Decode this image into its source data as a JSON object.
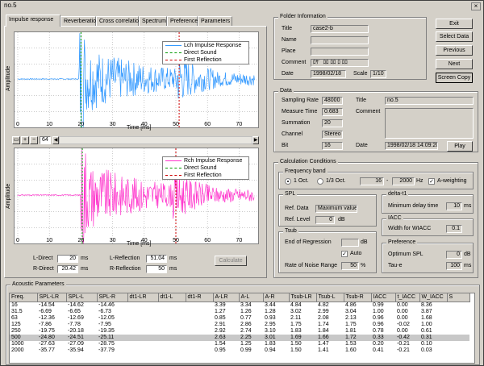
{
  "window": {
    "title": "no.5",
    "close": "×"
  },
  "tabs": [
    "Impulse response",
    "Reverberation",
    "Cross correlation",
    "Spectrum",
    "Preference",
    "Parameters"
  ],
  "plot_top": {
    "ylabel": "Amplitude",
    "xlabel": "Time [ms]",
    "xticks": [
      "0",
      "10",
      "20",
      "30",
      "40",
      "50",
      "60",
      "70"
    ],
    "legend": [
      "Lch Impulse Response",
      "Direct Sound",
      "First Reflection"
    ],
    "colors": {
      "response": "#3399ff",
      "direct": "#009900",
      "reflection": "#cc0000"
    }
  },
  "plot_bottom": {
    "ylabel": "Amplitude",
    "xlabel": "Time [ms]",
    "xticks": [
      "0",
      "10",
      "20",
      "30",
      "40",
      "50",
      "60",
      "70"
    ],
    "legend": [
      "Rch Impulse Response",
      "Direct Sound",
      "First Reflection"
    ],
    "colors": {
      "response": "#ff33cc",
      "direct": "#009900",
      "reflection": "#cc0000"
    }
  },
  "toolbar": {
    "zoom_value": "64"
  },
  "chart_data": [
    {
      "type": "line",
      "title": "",
      "xlabel": "Time [ms]",
      "ylabel": "Amplitude",
      "xlim": [
        0,
        75
      ],
      "series": [
        {
          "name": "Lch Impulse Response"
        },
        {
          "name": "Direct Sound",
          "x": 20
        },
        {
          "name": "First Reflection",
          "x": 51.04
        }
      ]
    },
    {
      "type": "line",
      "title": "",
      "xlabel": "Time [ms]",
      "ylabel": "Amplitude",
      "xlim": [
        0,
        75
      ],
      "series": [
        {
          "name": "Rch Impulse Response"
        },
        {
          "name": "Direct Sound",
          "x": 20.42
        },
        {
          "name": "First Reflection",
          "x": 50
        }
      ]
    }
  ],
  "positions": {
    "l_direct_label": "L-Direct",
    "l_direct": "20",
    "r_direct_label": "R-Direct",
    "r_direct": "20.42",
    "l_reflection_label": "L-Reflection",
    "l_reflection": "51.04",
    "r_reflection_label": "R-Reflection",
    "r_reflection": "50",
    "unit": "ms",
    "calculate": "Calculate"
  },
  "folder": {
    "group": "Folder Information",
    "title_label": "Title",
    "title": "case2-b",
    "name_label": "Name",
    "place_label": "Place",
    "comment_label": "Comment",
    "comment": "ﾛｻﾞ ﾛﾛ ﾛﾛ ﾛ ﾛﾛ",
    "date_label": "Date",
    "date": "1998/02/18",
    "scale_label": "Scale",
    "scale": "1/10"
  },
  "buttons": {
    "exit": "Exit",
    "select": "Select Data",
    "previous": "Previous",
    "next": "Next",
    "screen_copy": "Screen Copy"
  },
  "data": {
    "group": "Data",
    "rate_label": "Sampling Rate",
    "rate": "48000",
    "mtime_label": "Measure Time",
    "mtime": "0.683",
    "sum_label": "Summation",
    "sum": "20",
    "channel_label": "Channel",
    "channel": "Stereo",
    "bit_label": "Bit",
    "bit": "16",
    "title_label": "Title",
    "title": "no.5",
    "comment_label": "Comment",
    "date_label": "Date",
    "date": "1998/02/18 14:09:20",
    "play": "Play"
  },
  "calc": {
    "group": "Calculation Conditions",
    "band_group": "Frequency band",
    "oct1": "1 Oct.",
    "oct3": "1/3 Oct.",
    "f_low": "16",
    "f_high": "2000",
    "hz": "Hz",
    "aweight": "A-weighting",
    "spl_group": "SPL",
    "ref_data_label": "Ref. Data",
    "ref_data": "Maximum value",
    "ref_level_label": "Ref. Level",
    "ref_level": "0",
    "db": "dB",
    "dt1_group": "delta-t1",
    "min_delay_label": "Minimum delay time",
    "min_delay": "10",
    "ms": "ms",
    "tsub_group": "Tsub",
    "end_reg_label": "End of Regression",
    "auto": "Auto",
    "noise_label": "Rate of Noise Range",
    "noise": "50",
    "pct": "%",
    "iacc_group": "IACC",
    "w_iacc_label": "Width for WIACC",
    "w_iacc": "0.1",
    "pref_group": "Preference",
    "opt_spl_label": "Optimum SPL",
    "opt_spl": "0",
    "tau_label": "Tau-e",
    "tau": "100"
  },
  "acoustic": {
    "group": "Acoustic Parameters",
    "headers": [
      "Freq.",
      "SPL-LR",
      "SPL-L",
      "SPL-R",
      "dt1-LR",
      "dt1-L",
      "dt1-R",
      "A-LR",
      "A-L",
      "A-R",
      "Tsub-LR",
      "Tsub-L",
      "Tsub-R",
      "IACC",
      "t_IACC",
      "W_IACC",
      "S"
    ],
    "rows": [
      [
        "16",
        "-14.54",
        "-14.62",
        "-14.46",
        "",
        "",
        "",
        "3.39",
        "3.34",
        "3.44",
        "4.84",
        "4.82",
        "4.86",
        "0.99",
        "0.00",
        "8.36",
        ""
      ],
      [
        "31.5",
        "-6.69",
        "-6.65",
        "-6.73",
        "",
        "",
        "",
        "1.27",
        "1.26",
        "1.28",
        "3.02",
        "2.99",
        "3.04",
        "1.00",
        "0.00",
        "3.87",
        ""
      ],
      [
        "63",
        "-12.36",
        "-12.69",
        "-12.05",
        "",
        "",
        "",
        "0.85",
        "0.77",
        "0.93",
        "2.11",
        "2.08",
        "2.13",
        "0.96",
        "0.00",
        "1.68",
        ""
      ],
      [
        "125",
        "-7.86",
        "-7.78",
        "-7.95",
        "",
        "",
        "",
        "2.91",
        "2.86",
        "2.95",
        "1.75",
        "1.74",
        "1.75",
        "0.96",
        "-0.02",
        "1.00",
        ""
      ],
      [
        "250",
        "-19.75",
        "-20.18",
        "-19.35",
        "",
        "",
        "",
        "2.92",
        "2.74",
        "3.10",
        "1.83",
        "1.84",
        "1.81",
        "0.78",
        "0.00",
        "0.61",
        ""
      ],
      [
        "500",
        "-24.80",
        "-24.51",
        "-25.11",
        "",
        "",
        "",
        "2.63",
        "2.25",
        "3.01",
        "1.69",
        "1.66",
        "1.72",
        "0.33",
        "-0.42",
        "0.31",
        ""
      ],
      [
        "1000",
        "-27.63",
        "-27.09",
        "-28.75",
        "",
        "",
        "",
        "1.54",
        "1.25",
        "1.83",
        "1.50",
        "1.47",
        "1.53",
        "0.20",
        "-0.21",
        "0.10",
        ""
      ],
      [
        "2000",
        "-35.77",
        "-35.94",
        "-37.79",
        "",
        "",
        "",
        "0.95",
        "0.99",
        "0.94",
        "1.50",
        "1.41",
        "1.60",
        "0.41",
        "-0.21",
        "0.03",
        ""
      ]
    ]
  }
}
